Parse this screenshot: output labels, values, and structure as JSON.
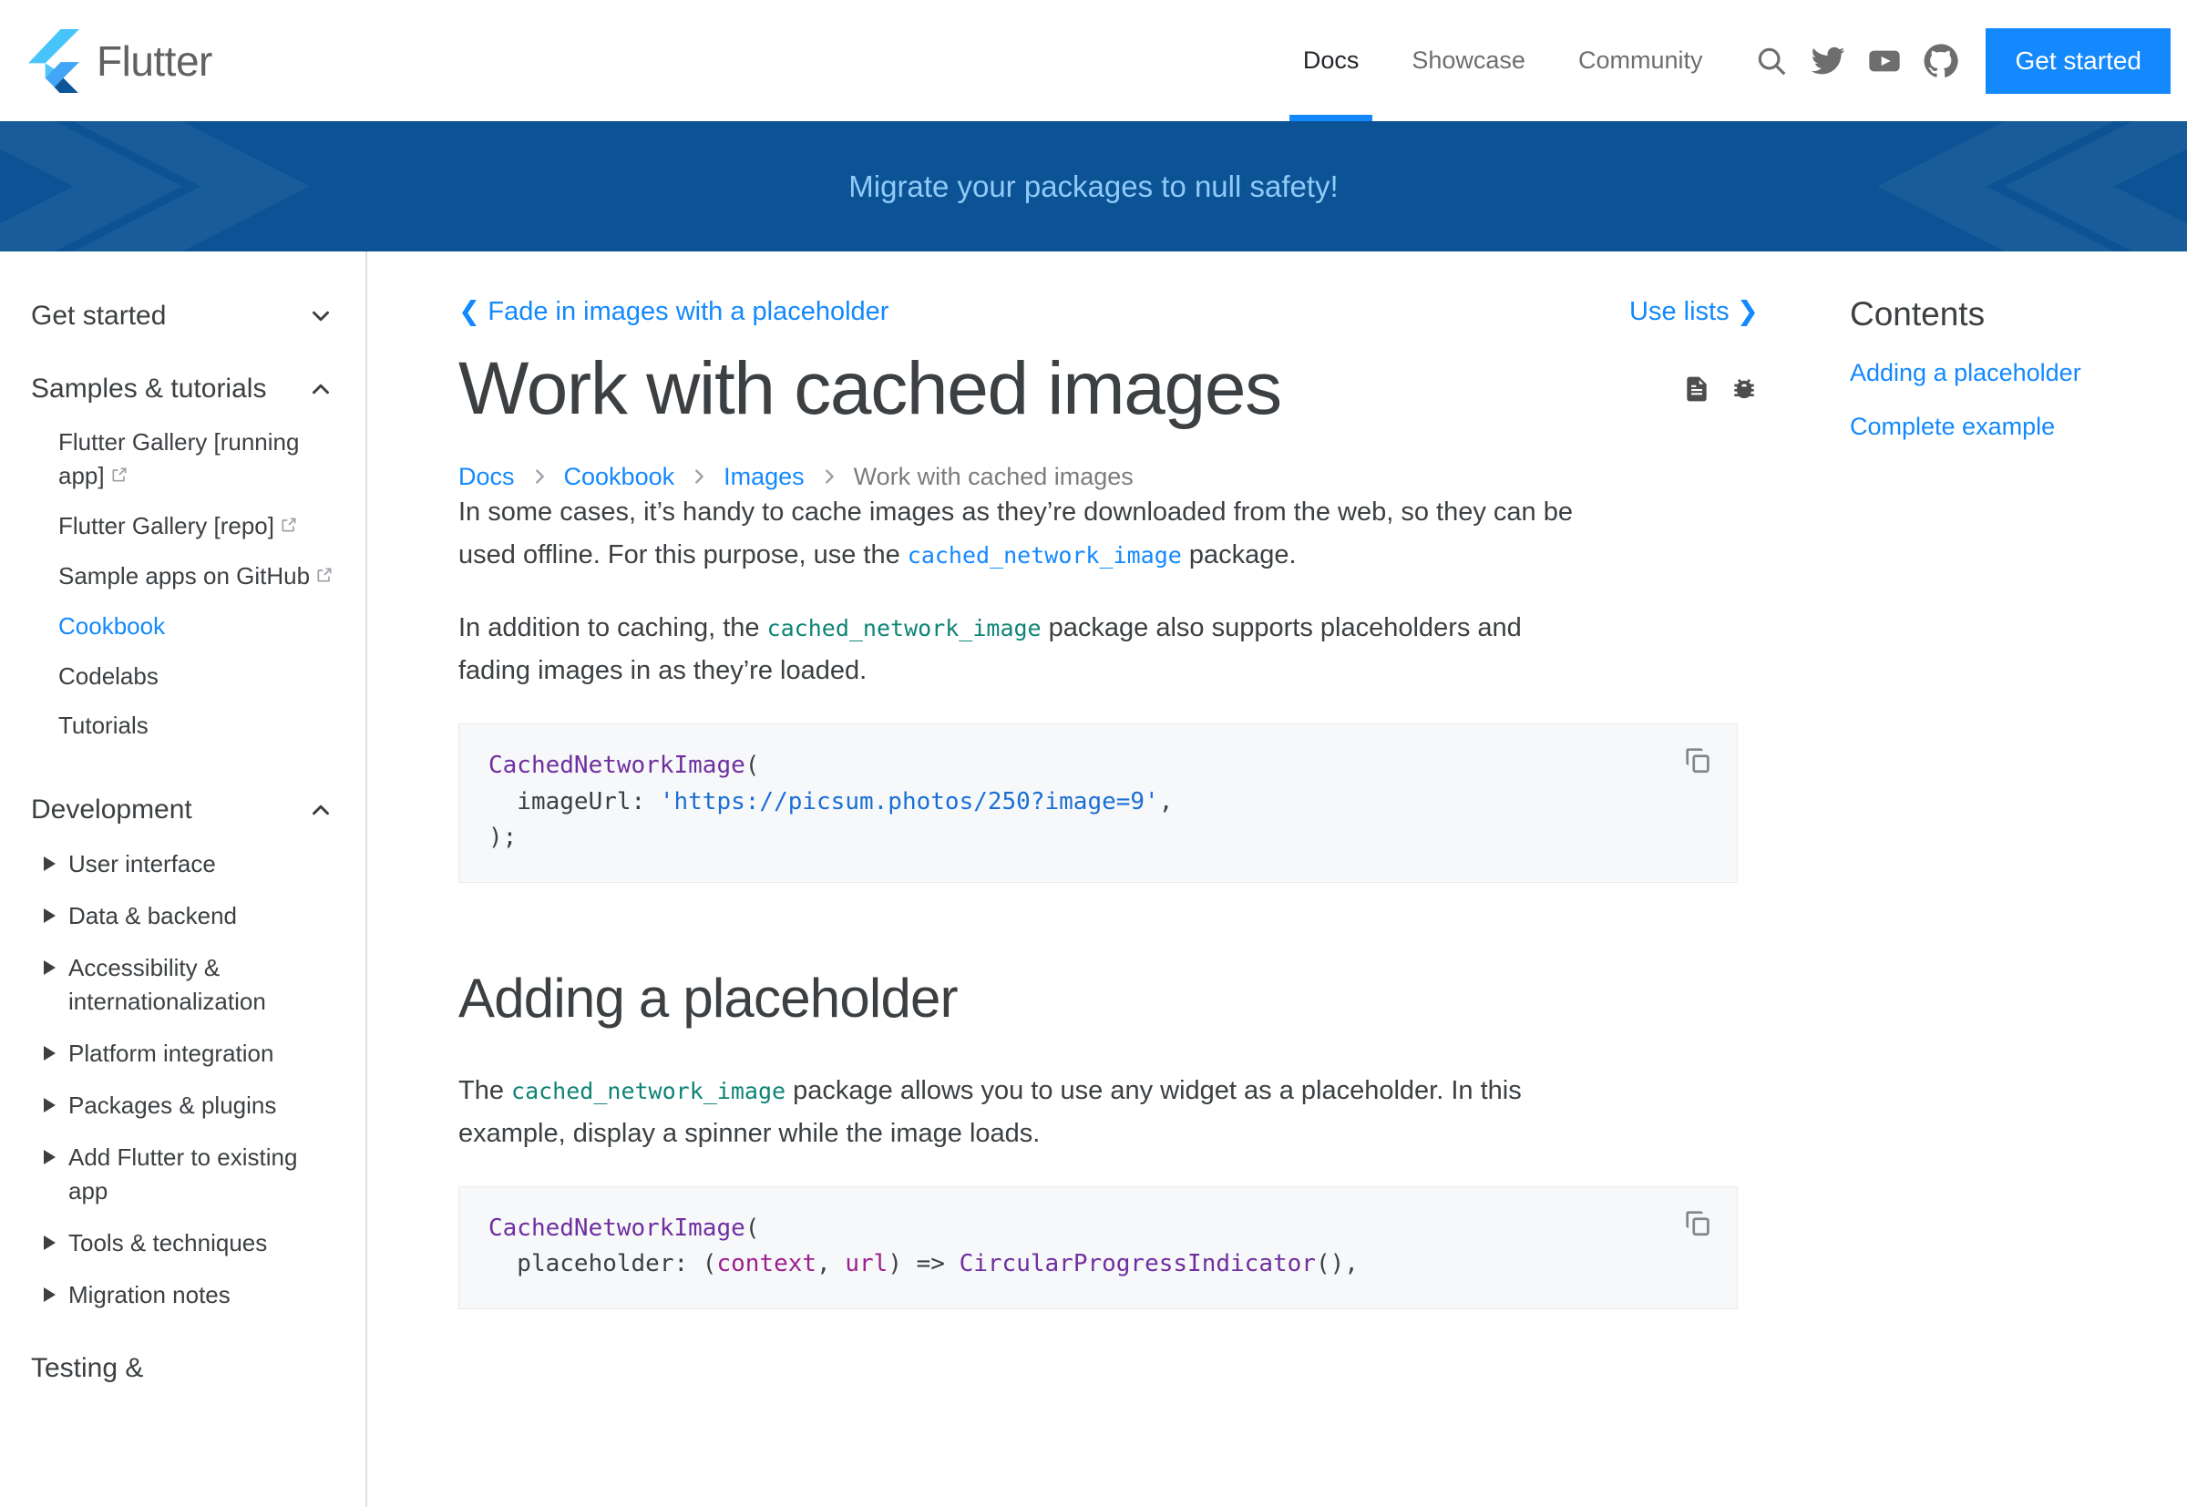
{
  "nav": {
    "brand": "Flutter",
    "brand_icon": "flutter-logo-icon",
    "links": [
      {
        "label": "Docs",
        "active": true
      },
      {
        "label": "Showcase",
        "active": false
      },
      {
        "label": "Community",
        "active": false
      }
    ],
    "icons": [
      {
        "name": "search-icon"
      },
      {
        "name": "twitter-icon"
      },
      {
        "name": "youtube-icon"
      },
      {
        "name": "github-icon"
      }
    ],
    "cta": "Get started",
    "accent_color": "#1389fd"
  },
  "banner": {
    "text": "Migrate your packages to null safety!",
    "bg_color": "#0b5394",
    "text_color": "#8fcaf9"
  },
  "sidebar": {
    "groups": [
      {
        "label": "Get started",
        "chevron": "chevron-down-icon",
        "expanded": false,
        "items": []
      },
      {
        "label": "Samples & tutorials",
        "chevron": "chevron-up-icon",
        "expanded": true,
        "items": [
          {
            "label": "Flutter Gallery [running app]",
            "external": true,
            "active": false
          },
          {
            "label": "Flutter Gallery [repo]",
            "external": true,
            "active": false
          },
          {
            "label": "Sample apps on GitHub",
            "external": true,
            "active": false
          },
          {
            "label": "Cookbook",
            "external": false,
            "active": true
          },
          {
            "label": "Codelabs",
            "external": false,
            "active": false
          },
          {
            "label": "Tutorials",
            "external": false,
            "active": false
          }
        ]
      },
      {
        "label": "Development",
        "chevron": "chevron-up-icon",
        "expanded": true,
        "expandables": [
          "User interface",
          "Data & backend",
          "Accessibility & internationalization",
          "Platform integration",
          "Packages & plugins",
          "Add Flutter to existing app",
          "Tools & techniques",
          "Migration notes"
        ]
      },
      {
        "label": "Testing &",
        "chevron": "",
        "expanded": false,
        "items": []
      }
    ]
  },
  "pager": {
    "prev_label": "Fade in images with a placeholder",
    "prev_arrow": "❮",
    "next_label": "Use lists",
    "next_arrow": "❯"
  },
  "page": {
    "title": "Work with cached images",
    "title_icons": [
      {
        "name": "page-source-icon"
      },
      {
        "name": "bug-report-icon"
      }
    ],
    "breadcrumbs": [
      {
        "label": "Docs",
        "link": true
      },
      {
        "label": "Cookbook",
        "link": true
      },
      {
        "label": "Images",
        "link": true
      },
      {
        "label": "Work with cached images",
        "link": false
      }
    ],
    "paragraph_1_a": "In some cases, it’s handy to cache images as they’re downloaded from the web, so they can be used offline. For this purpose, use the ",
    "paragraph_1_code": "cached_network_image",
    "paragraph_1_b": " package.",
    "paragraph_2_a": "In addition to caching, the ",
    "paragraph_2_code": "cached_network_image",
    "paragraph_2_b": " package also supports placeholders and fading images in as they’re loaded.",
    "code_1_line1_class": "CachedNetworkImage",
    "code_1_line1_rest": "(",
    "code_1_line2_pre": "  imageUrl: ",
    "code_1_line2_str": "'https://picsum.photos/250?image=9'",
    "code_1_line2_post": ",",
    "code_1_line3": ");",
    "section_2_title": "Adding a placeholder",
    "paragraph_3_a": "The ",
    "paragraph_3_code": "cached_network_image",
    "paragraph_3_b": " package allows you to use any widget as a placeholder. In this example, display a spinner while the image loads.",
    "code_2_line1_class": "CachedNetworkImage",
    "code_2_line1_rest": "(",
    "code_2_line2_pre": "  placeholder: (",
    "code_2_line2_p1": "context",
    "code_2_line2_mid": ", ",
    "code_2_line2_p2": "url",
    "code_2_line2_post": ") => ",
    "code_2_line2_cls": "CircularProgressIndicator",
    "code_2_line2_end": "(),",
    "copy_label": "copy-icon"
  },
  "toc": {
    "title": "Contents",
    "items": [
      {
        "label": "Adding a placeholder"
      },
      {
        "label": "Complete example"
      }
    ]
  }
}
